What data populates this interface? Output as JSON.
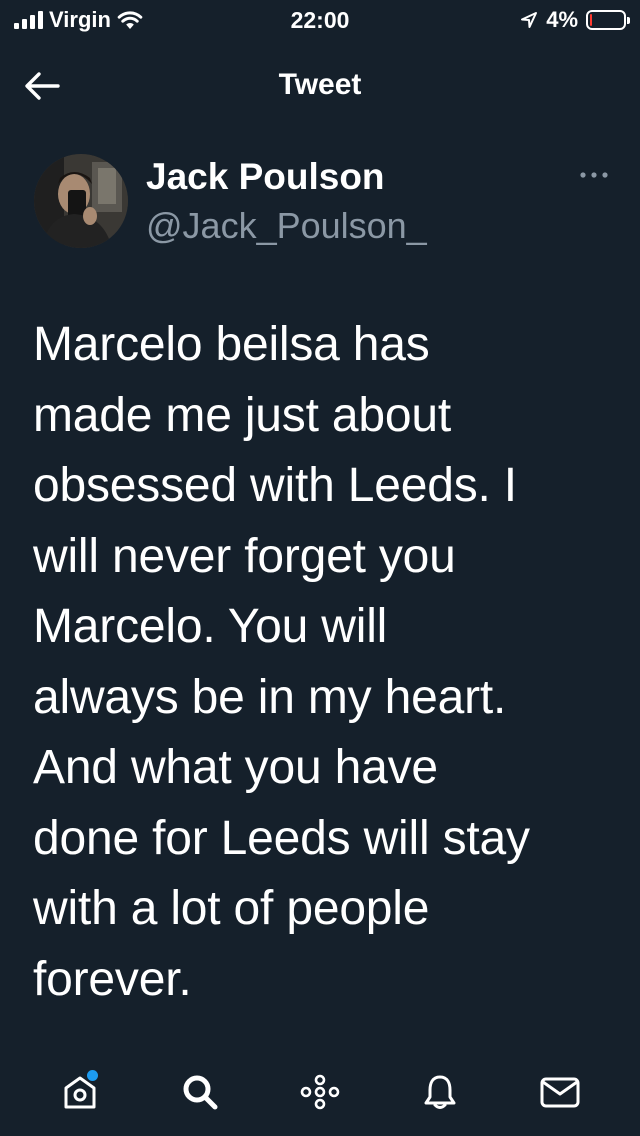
{
  "status_bar": {
    "carrier": "Virgin",
    "time": "22:00",
    "battery_percent": "4%",
    "battery_level": 0.04,
    "battery_color": "#ff3b30",
    "icons": [
      "signal-icon",
      "wifi-icon",
      "location-arrow-icon",
      "battery-icon"
    ]
  },
  "header": {
    "title": "Tweet",
    "back_icon": "arrow-left-icon"
  },
  "tweet": {
    "author": {
      "display_name": "Jack Poulson",
      "handle": "@Jack_Poulson_"
    },
    "text": "Marcelo beilsa has\nmade me just about\nobsessed with Leeds. I\nwill never forget you\nMarcelo. You will\nalways be in my heart.\nAnd what you have\ndone for Leeds will stay\nwith a lot of people\nforever.",
    "more_icon": "more-dots-icon"
  },
  "tab_bar": {
    "items": [
      {
        "icon": "home-icon",
        "has_notification": true
      },
      {
        "icon": "search-icon"
      },
      {
        "icon": "spaces-icon"
      },
      {
        "icon": "notifications-bell-icon"
      },
      {
        "icon": "messages-envelope-icon"
      }
    ]
  },
  "colors": {
    "background": "#15202b",
    "text_primary": "#ffffff",
    "text_secondary": "#8b98a5",
    "accent": "#1d9bf0"
  }
}
